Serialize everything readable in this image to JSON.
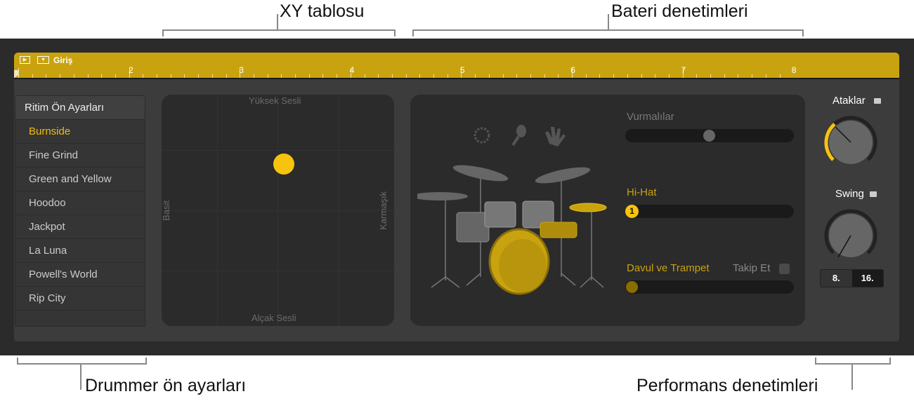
{
  "callouts": {
    "xy": "XY tablosu",
    "drum": "Bateri denetimleri",
    "presets": "Drummer ön ayarları",
    "performance": "Performans denetimleri"
  },
  "region": {
    "name": "Giriş",
    "ruler": [
      "2",
      "3",
      "4",
      "5",
      "6",
      "7",
      "8"
    ],
    "color": "#c9a30f"
  },
  "presets": {
    "header": "Ritim Ön Ayarları",
    "items": [
      "Burnside",
      "Fine Grind",
      "Green and Yellow",
      "Hoodoo",
      "Jackpot",
      "La Luna",
      "Powell's World",
      "Rip City"
    ],
    "selected": "Burnside"
  },
  "xy": {
    "top": "Yüksek Sesli",
    "bottom": "Alçak Sesli",
    "left": "Basit",
    "right": "Karmaşık",
    "puck_color": "#f7c30d"
  },
  "drum": {
    "percussion_label": "Vurmalılar",
    "percussion_value": 0.5,
    "hihat_label": "Hi-Hat",
    "hihat_value_badge": "1",
    "kick_label": "Davul ve Trampet",
    "follow_label": "Takip Et",
    "follow_checked": false,
    "icons": [
      "tambourine-icon",
      "shaker-icon",
      "handclap-icon"
    ],
    "accent": "#f2bd12"
  },
  "performance": {
    "fills_label": "Ataklar",
    "swing_label": "Swing",
    "fills_locked": false,
    "swing_locked": false,
    "swing_buttons": [
      "8.",
      "16."
    ],
    "swing_selected": "16."
  }
}
